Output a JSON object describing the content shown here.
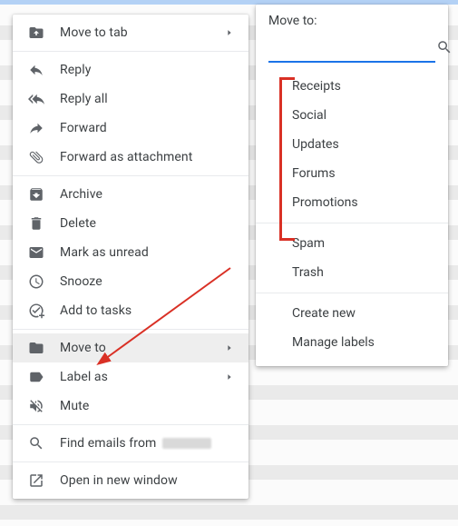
{
  "menu": {
    "move_to_tab": "Move to tab",
    "reply": "Reply",
    "reply_all": "Reply all",
    "forward": "Forward",
    "forward_attach": "Forward as attachment",
    "archive": "Archive",
    "delete": "Delete",
    "mark_unread": "Mark as unread",
    "snooze": "Snooze",
    "add_tasks": "Add to tasks",
    "move_to": "Move to",
    "label_as": "Label as",
    "mute": "Mute",
    "find_emails": "Find emails from",
    "open_new_window": "Open in new window"
  },
  "submenu": {
    "title": "Move to:",
    "search_placeholder": "",
    "labels": {
      "receipts": "Receipts",
      "social": "Social",
      "updates": "Updates",
      "forums": "Forums",
      "promotions": "Promotions"
    },
    "special": {
      "spam": "Spam",
      "trash": "Trash"
    },
    "actions": {
      "create_new": "Create new",
      "manage": "Manage labels"
    }
  }
}
